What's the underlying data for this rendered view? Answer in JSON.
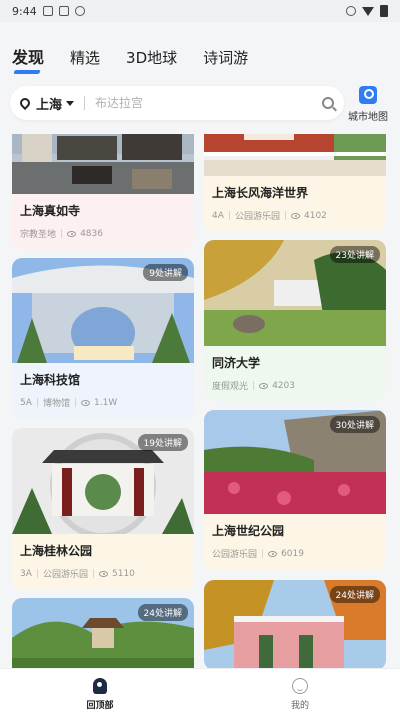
{
  "status_bar": {
    "time": "9:44"
  },
  "tabs": [
    {
      "label": "发现",
      "active": true
    },
    {
      "label": "精选",
      "active": false
    },
    {
      "label": "3D地球",
      "active": false
    },
    {
      "label": "诗词游",
      "active": false
    }
  ],
  "search": {
    "city": "上海",
    "placeholder": "布达拉宫"
  },
  "city_map": {
    "label": "城市地图"
  },
  "cards": {
    "left": [
      {
        "title": "上海真如寺",
        "tag": "",
        "category": "宗教圣地",
        "views": "4836",
        "badge": ""
      },
      {
        "title": "上海科技馆",
        "tag": "5A",
        "category": "博物馆",
        "views": "1.1W",
        "badge": "9处讲解"
      },
      {
        "title": "上海桂林公园",
        "tag": "3A",
        "category": "公园游乐园",
        "views": "5110",
        "badge": "19处讲解"
      },
      {
        "title": "",
        "tag": "",
        "category": "",
        "views": "",
        "badge": "24处讲解"
      }
    ],
    "right": [
      {
        "title": "上海长风海洋世界",
        "tag": "4A",
        "category": "公园游乐园",
        "views": "4102",
        "badge": ""
      },
      {
        "title": "同济大学",
        "tag": "",
        "category": "度假观光",
        "views": "4203",
        "badge": "23处讲解"
      },
      {
        "title": "上海世纪公园",
        "tag": "",
        "category": "公园游乐园",
        "views": "6019",
        "badge": "30处讲解"
      },
      {
        "title": "",
        "tag": "",
        "category": "",
        "views": "",
        "badge": "24处讲解"
      }
    ]
  },
  "bottom_nav": [
    {
      "label": "回顶部",
      "active": true,
      "icon": "rocket-icon"
    },
    {
      "label": "我的",
      "active": false,
      "icon": "profile-face-icon"
    }
  ],
  "colors": {
    "accent": "#2f7cf6"
  }
}
